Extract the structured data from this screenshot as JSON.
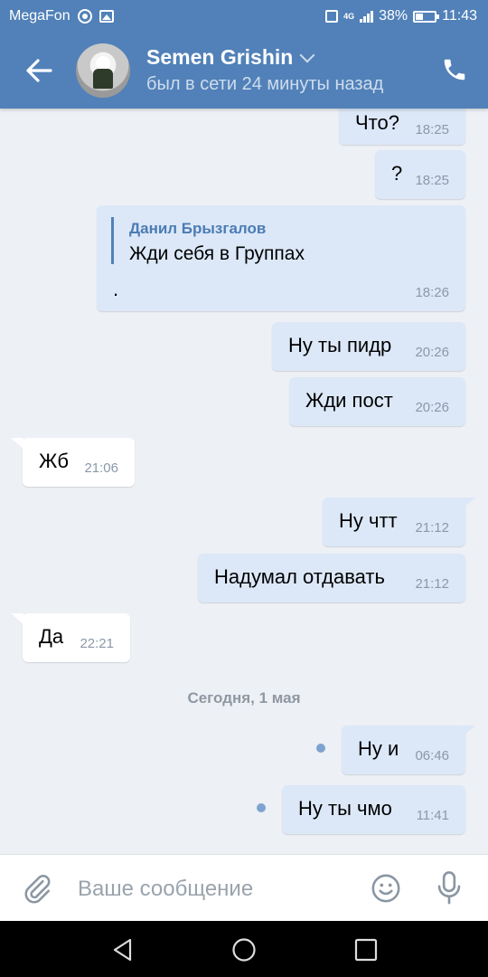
{
  "status_bar": {
    "carrier": "MegaFon",
    "network": "4G",
    "battery": "38%",
    "time": "11:43"
  },
  "header": {
    "contact_name": "Semen Grishin",
    "last_seen": "был в сети 24 минуты назад",
    "back_icon": "arrow-left-icon",
    "call_icon": "phone-icon"
  },
  "messages": [
    {
      "dir": "out",
      "text": "Что?",
      "time": "18:25"
    },
    {
      "dir": "out",
      "text": "?",
      "time": "18:25"
    },
    {
      "dir": "out",
      "quote_author": "Данил Брызгалов",
      "quote_text": "Жди себя в Группах",
      "text": ".",
      "time": "18:26"
    },
    {
      "dir": "out",
      "text": "Ну ты пидр",
      "time": "20:26"
    },
    {
      "dir": "out",
      "text": "Жди пост",
      "time": "20:26"
    },
    {
      "dir": "in",
      "text": "Жб",
      "time": "21:06"
    },
    {
      "dir": "out",
      "text": "Ну чтт",
      "time": "21:12"
    },
    {
      "dir": "out",
      "text": "Надумал отдавать",
      "time": "21:12"
    },
    {
      "dir": "in",
      "text": "Да",
      "time": "22:21"
    },
    {
      "dir": "out",
      "text": "Ну и",
      "time": "06:46",
      "unread": true
    },
    {
      "dir": "out",
      "text": "Ну ты чмо",
      "time": "11:41",
      "unread": true
    }
  ],
  "date_separator": "Сегодня, 1 мая",
  "input": {
    "placeholder": "Ваше сообщение"
  },
  "colors": {
    "brand": "#5181b8",
    "chat_bg": "#edf0f5",
    "outgoing_bubble": "#dce8f8",
    "incoming_bubble": "#ffffff"
  }
}
